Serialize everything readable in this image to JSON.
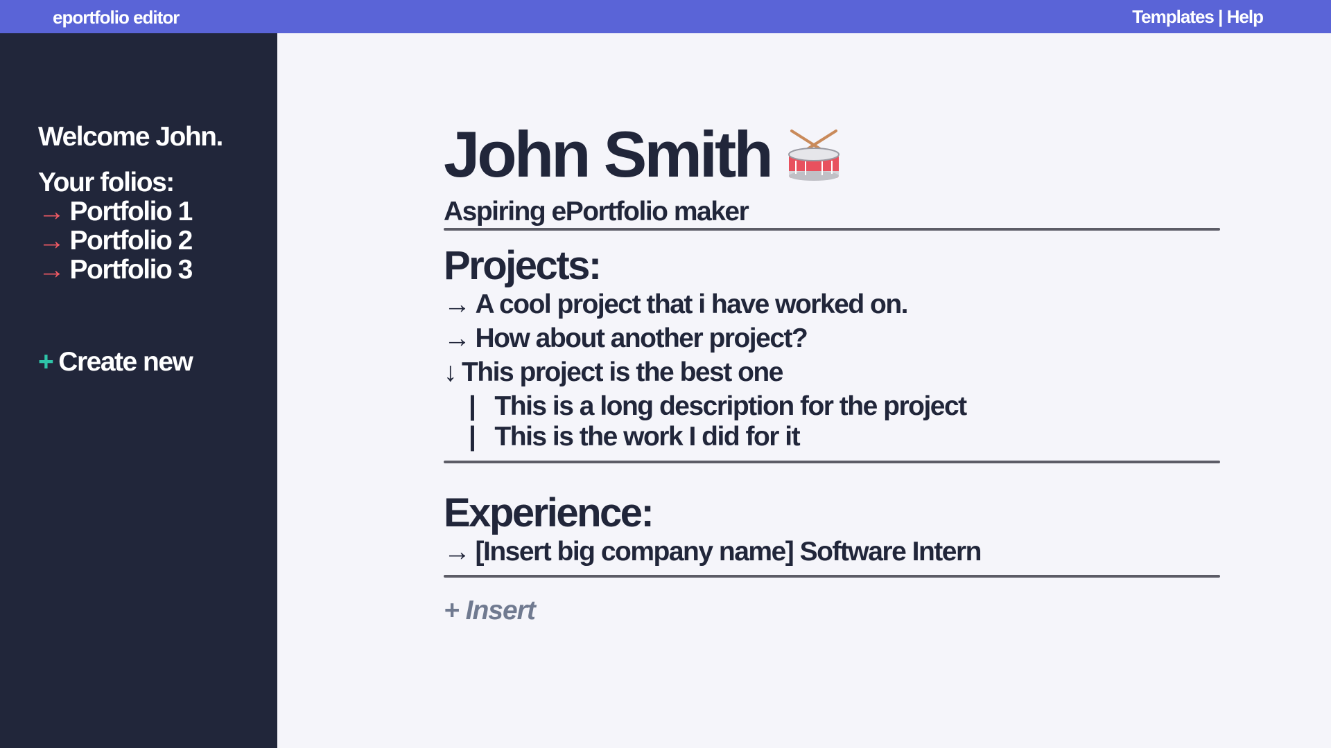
{
  "app": {
    "title": "eportfolio editor"
  },
  "topnav": {
    "templates": "Templates",
    "separator": "|",
    "help": "Help"
  },
  "sidebar": {
    "welcome": "Welcome John.",
    "folios_label": "Your folios:",
    "arrow": "→",
    "folios": [
      "Portfolio 1",
      "Portfolio 2",
      "Portfolio 3"
    ],
    "create_plus": "+",
    "create_label": "Create new"
  },
  "profile": {
    "name": "John Smith",
    "icon": "drum-icon",
    "subtitle": "Aspiring ePortfolio maker"
  },
  "projects": {
    "heading": "Projects:",
    "items": [
      {
        "marker": "→",
        "label": "A cool project that i have worked on."
      },
      {
        "marker": "→",
        "label": "How about another project?"
      },
      {
        "marker": "↓",
        "label": "This project is the best one"
      }
    ],
    "expanded_details": [
      {
        "marker": "|",
        "label": "This is a long description for the project"
      },
      {
        "marker": "|",
        "label": "This is the work I did for it"
      }
    ]
  },
  "experience": {
    "heading": "Experience:",
    "items": [
      {
        "marker": "→",
        "label": "[Insert big company name] Software Intern"
      }
    ]
  },
  "insert": {
    "plus": "+",
    "label": "Insert"
  },
  "colors": {
    "topbar": "#5a64d7",
    "sidebar": "#21263a",
    "main_bg": "#f5f5fa",
    "folio_arrow": "#f05a64",
    "create_plus": "#2ec4a8",
    "insert_text": "#707a90",
    "rule": "#5c5c66"
  }
}
